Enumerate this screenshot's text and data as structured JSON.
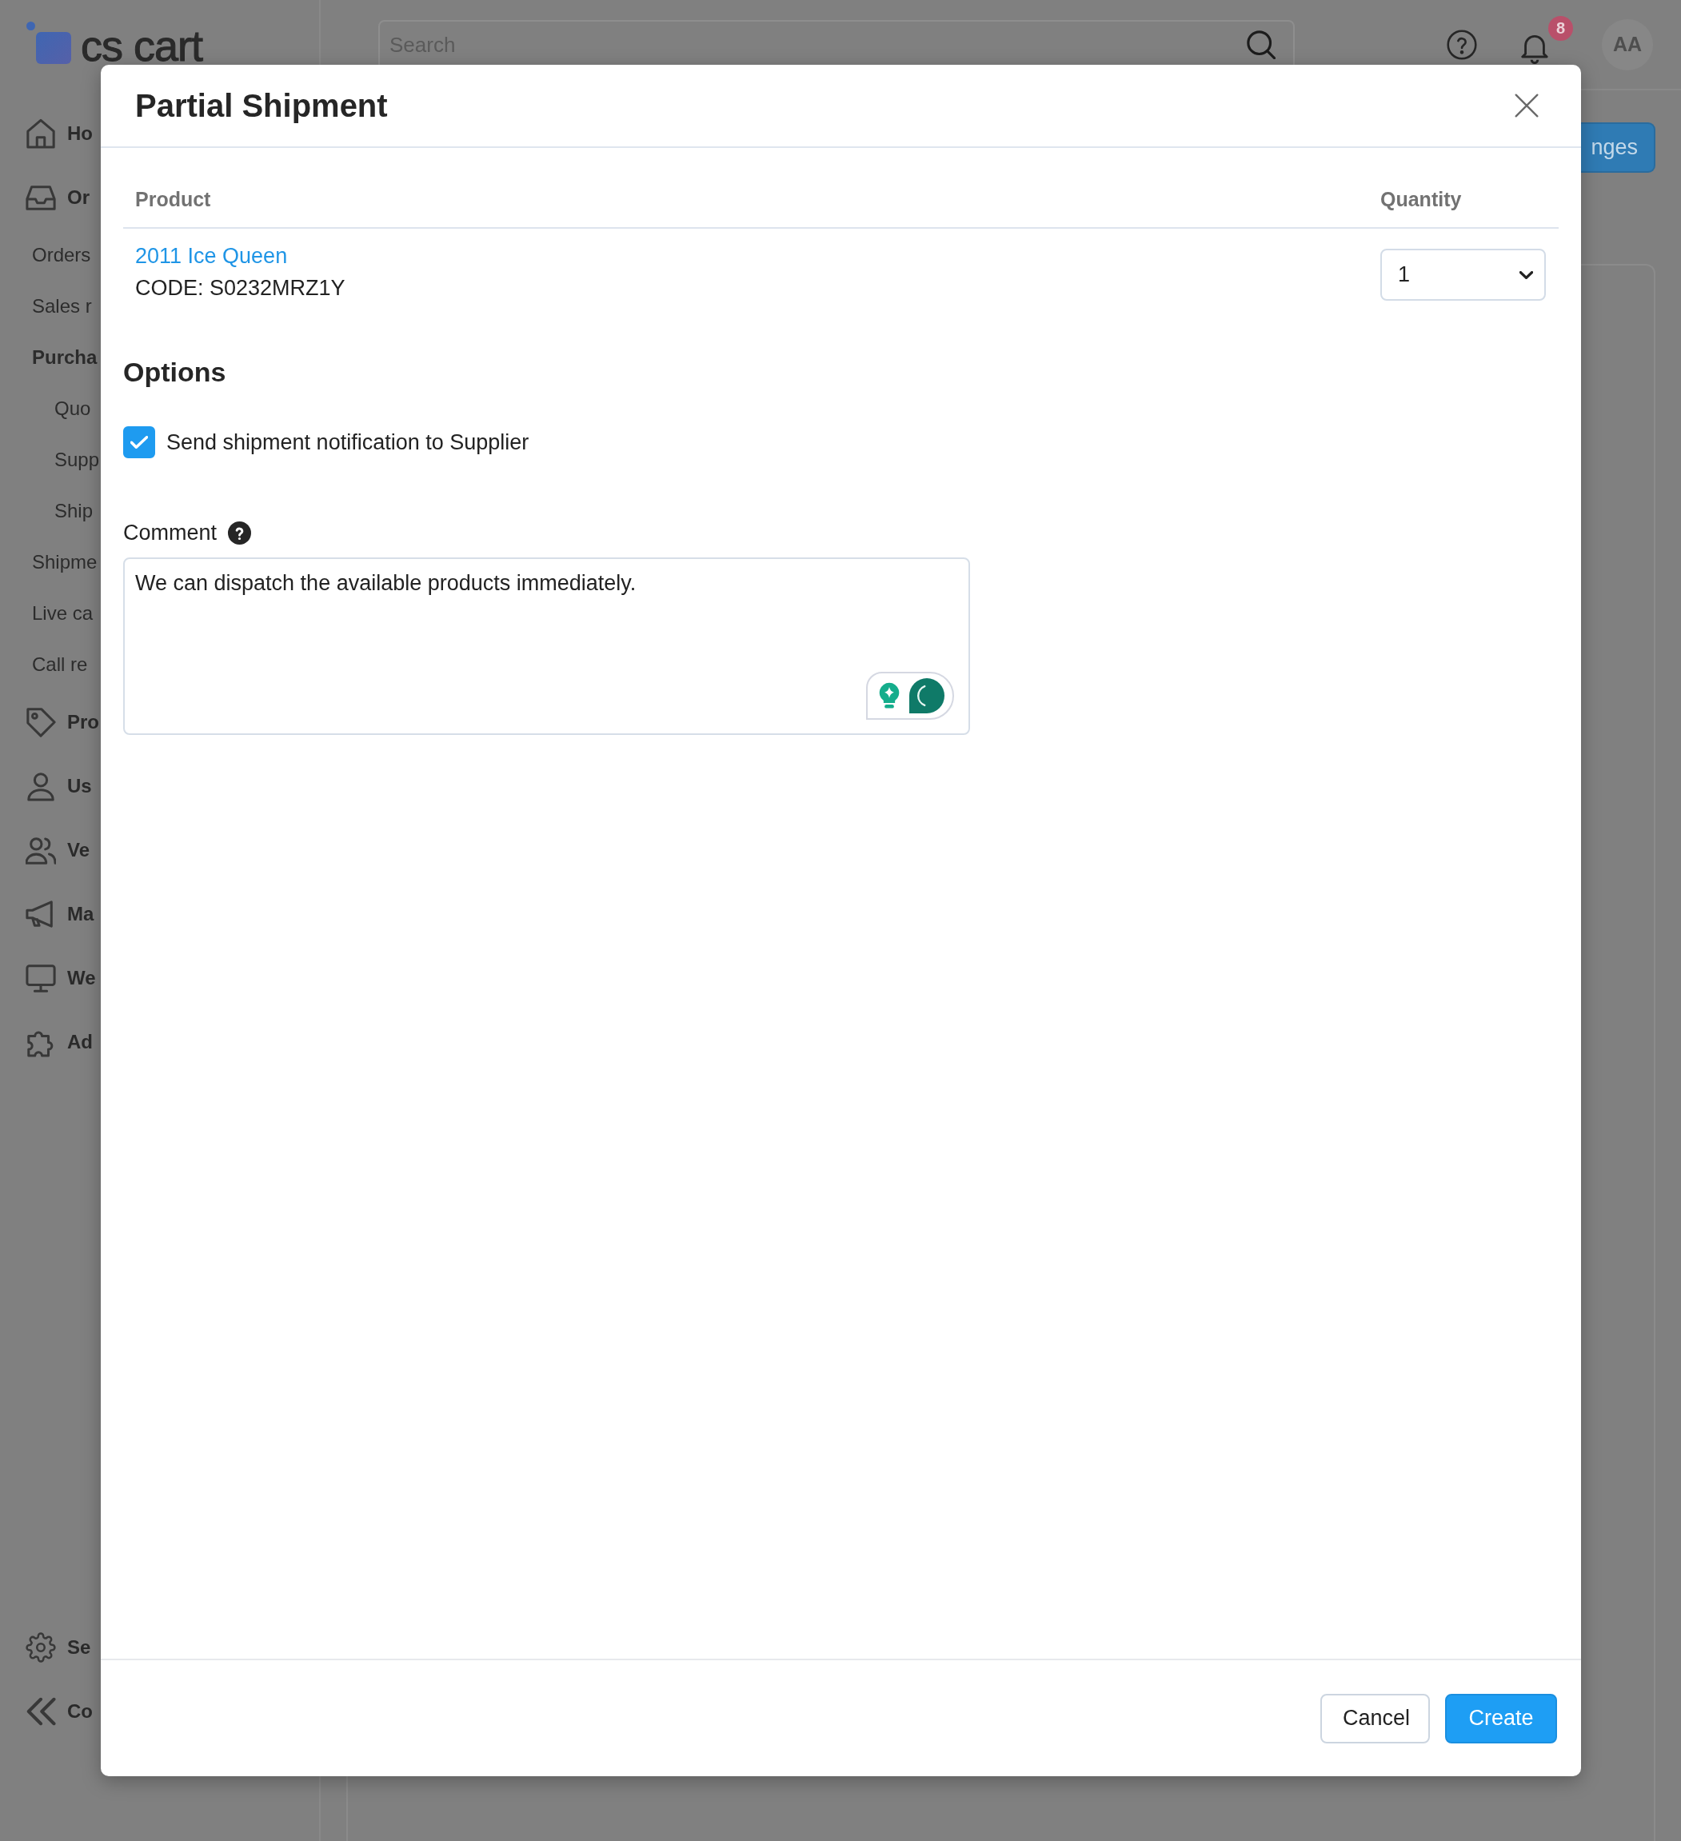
{
  "header": {
    "logo": "cs cart",
    "search": {
      "placeholder": "Search"
    },
    "notifications": {
      "count": "8"
    },
    "avatar": {
      "initials": "AA"
    }
  },
  "sidebar": {
    "items": [
      {
        "label": "Ho"
      },
      {
        "label": "Or",
        "children": [
          {
            "label": "Orders"
          },
          {
            "label": "Sales r"
          },
          {
            "label": "Purcha",
            "children": [
              {
                "label": "Quo"
              },
              {
                "label": "Supp"
              },
              {
                "label": "Ship"
              }
            ]
          },
          {
            "label": "Shipme"
          },
          {
            "label": "Live ca"
          },
          {
            "label": "Call re"
          }
        ]
      },
      {
        "label": "Pro"
      },
      {
        "label": "Us"
      },
      {
        "label": "Ve"
      },
      {
        "label": "Ma"
      },
      {
        "label": "We"
      },
      {
        "label": "Ad"
      }
    ],
    "bottom_items": [
      {
        "label": "Se"
      },
      {
        "label": "Co"
      }
    ]
  },
  "page": {
    "action_button": "nges"
  },
  "dialog": {
    "title": "Partial Shipment",
    "table": {
      "columns": [
        "Product",
        "Quantity"
      ],
      "rows": [
        {
          "product": "2011 Ice Queen",
          "code": "CODE: S0232MRZ1Y",
          "quantity": "1"
        }
      ]
    },
    "options": {
      "heading": "Options",
      "checkboxes": [
        {
          "label": "Send shipment notification to Supplier",
          "checked": true
        }
      ]
    },
    "comment": {
      "label": "Comment",
      "value": "We can dispatch the available products immediately."
    },
    "buttons": [
      {
        "label": "Cancel",
        "kind": "secondary"
      },
      {
        "label": "Create",
        "kind": "primary"
      }
    ]
  }
}
